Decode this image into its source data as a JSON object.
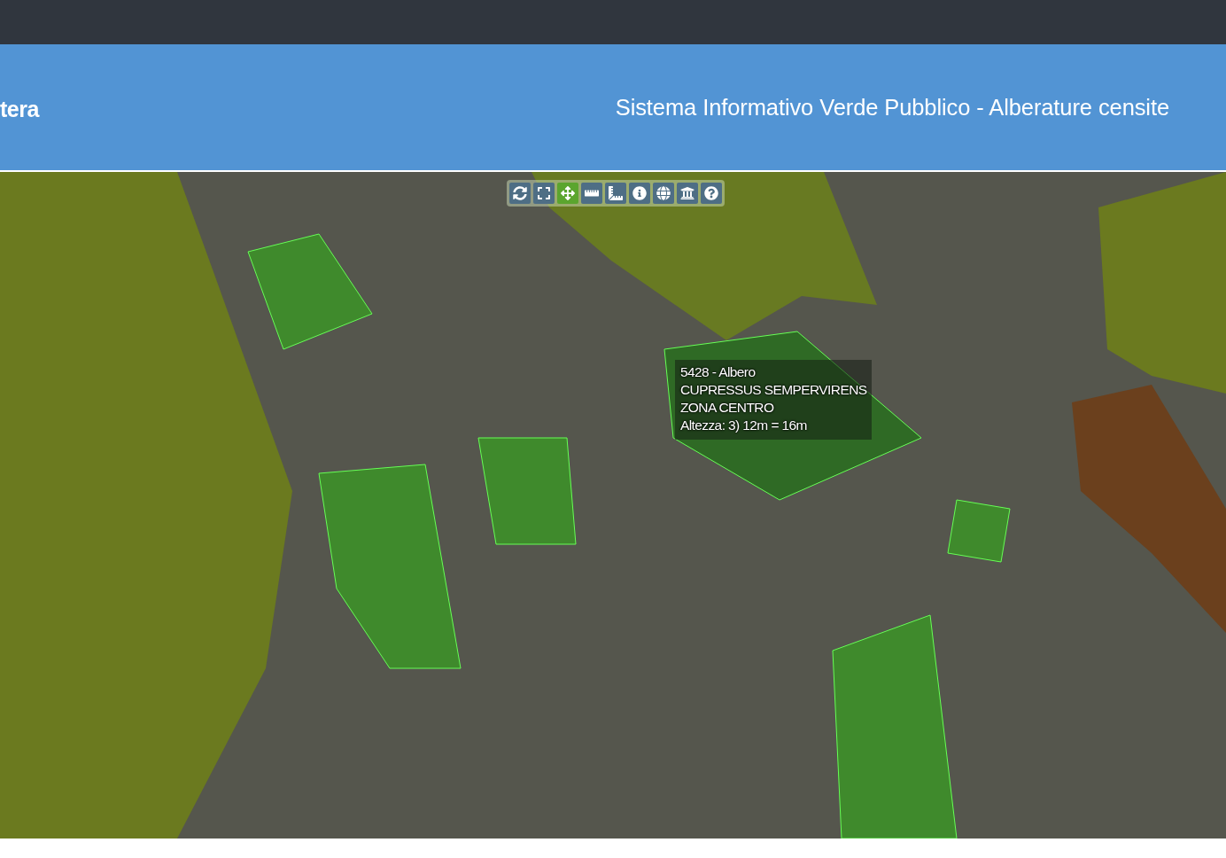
{
  "header": {
    "logo_text": "tera",
    "title": "Sistema Informativo Verde Pubblico - Alberature censite"
  },
  "map": {
    "toolbar": [
      {
        "selected": false
      },
      {
        "selected": false
      },
      {
        "selected": true
      },
      {
        "selected": false
      },
      {
        "selected": false
      },
      {
        "selected": false
      },
      {
        "selected": false
      },
      {
        "selected": false
      },
      {
        "selected": false
      }
    ],
    "tooltip": {
      "lines": [
        "5428 - Albero",
        "CUPRESSUS SEMPERVIRENS",
        "ZONA CENTRO",
        "Altezza: 3) 12m = 16m"
      ]
    }
  }
}
